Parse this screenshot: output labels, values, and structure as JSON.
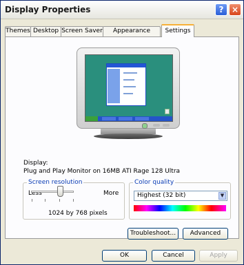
{
  "window": {
    "title": "Display Properties",
    "help_icon_glyph": "?",
    "close_icon_glyph": "×"
  },
  "tabs": [
    {
      "label": "Themes",
      "active": false
    },
    {
      "label": "Desktop",
      "active": false
    },
    {
      "label": "Screen Saver",
      "active": false
    },
    {
      "label": "Appearance",
      "active": false
    },
    {
      "label": "Settings",
      "active": true
    }
  ],
  "display": {
    "label": "Display:",
    "value": "Plug and Play Monitor on 16MB ATI Rage 128 Ultra"
  },
  "screen_resolution": {
    "title": "Screen resolution",
    "less_label": "Less",
    "more_label": "More",
    "value_text": "1024 by 768 pixels",
    "slider_level": 0.62
  },
  "color_quality": {
    "title": "Color quality",
    "selected": "Highest (32 bit)",
    "dropdown_icon": "chevron-down-icon"
  },
  "buttons": {
    "troubleshoot": "Troubleshoot...",
    "advanced": "Advanced",
    "ok": "OK",
    "cancel": "Cancel",
    "apply": "Apply"
  },
  "colors": {
    "title_accent": "#0a246a",
    "active_tab_accent": "#f7b037",
    "group_title": "#0a3cb4",
    "desktop_background": "#2a8f7d"
  }
}
